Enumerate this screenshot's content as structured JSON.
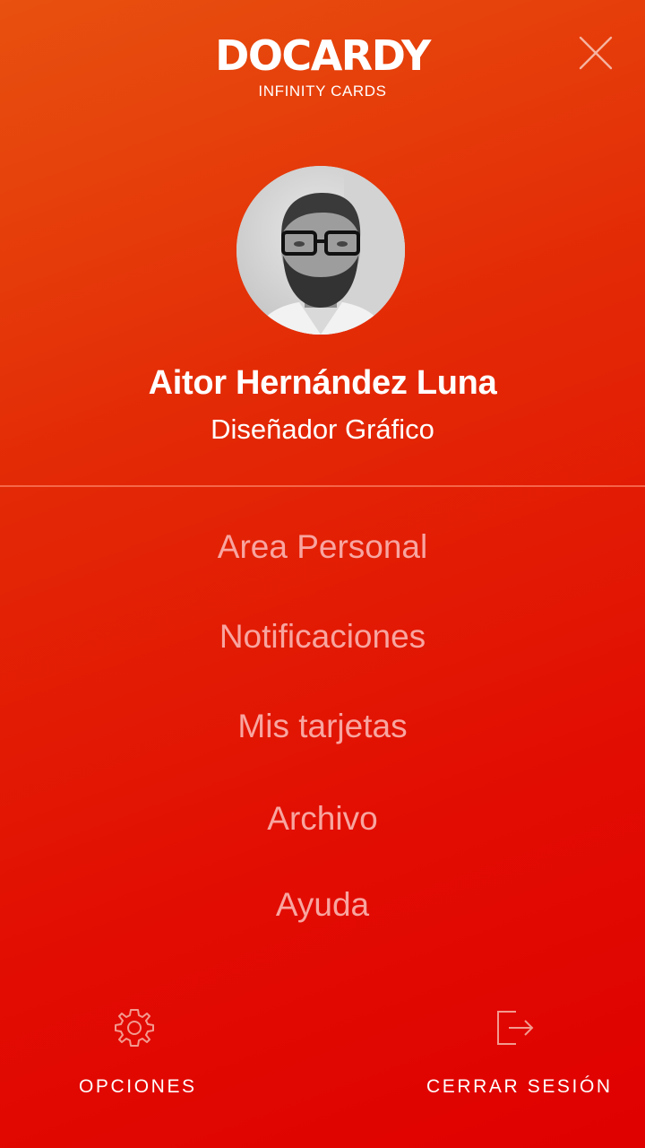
{
  "header": {
    "logo_title": "DOCARDY",
    "logo_subtitle": "INFINITY CARDS",
    "close_icon": "close-icon"
  },
  "profile": {
    "avatar_icon": "avatar-photo",
    "name": "Aitor Hernández Luna",
    "role": "Diseñador Gráfico"
  },
  "menu": {
    "items": [
      {
        "label": "Area Personal"
      },
      {
        "label": "Notificaciones"
      },
      {
        "label": "Mis tarjetas"
      },
      {
        "label": "Archivo"
      },
      {
        "label": "Ayuda"
      }
    ]
  },
  "footer": {
    "options_label": "OPCIONES",
    "options_icon": "gear-icon",
    "logout_label": "CERRAR SESIÓN",
    "logout_icon": "logout-icon"
  },
  "colors": {
    "background_top": "#e8510f",
    "background_bottom": "#df0000",
    "menu_text": "#f8a5a0",
    "icon_stroke": "#f39a8f"
  }
}
